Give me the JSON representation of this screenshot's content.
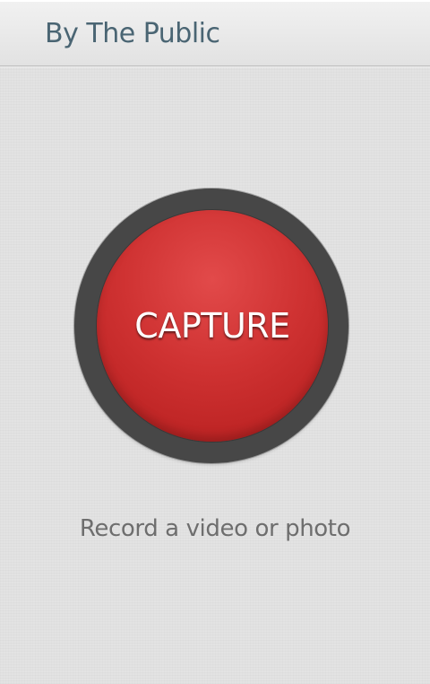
{
  "app_bar": {
    "title": "By The Public"
  },
  "capture": {
    "label": "CAPTURE",
    "button_color": "#cf3232",
    "ring_color": "#474747"
  },
  "subtitle": "Record a video or photo",
  "colors": {
    "title_text": "#4a6573",
    "subtitle_text": "#6e6e6e",
    "background": "#e3e3e3"
  }
}
